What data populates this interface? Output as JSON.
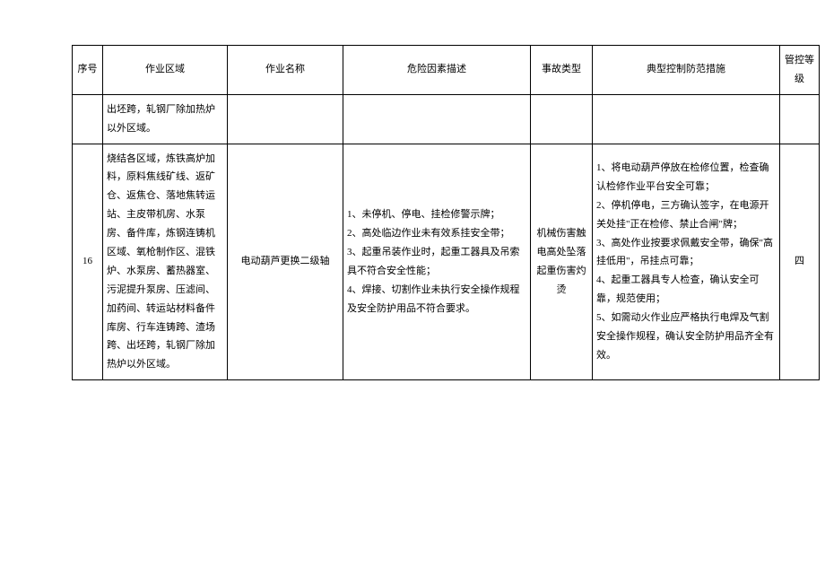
{
  "header": {
    "seq": "序号",
    "area": "作业区域",
    "name": "作业名称",
    "hazard": "危险因素描述",
    "type": "事故类型",
    "measure": "典型控制防范措施",
    "level": "管控等级"
  },
  "row_partial": {
    "seq": "",
    "area": "出坯跨，轧钢厂除加热炉以外区域。",
    "name": "",
    "hazard": "",
    "type": "",
    "measure": "",
    "level": ""
  },
  "row_16": {
    "seq": "16",
    "area": "烧结各区域，炼铁高炉加料，原料焦线矿线、返矿仓、返焦仓、落地焦转运站、主皮带机房、水泵房、备件库，炼钢连铸机区域、氧枪制作区、混铁炉、水泵房、蓄热器室、污泥提升泵房、压滤间、加药间、转运站材料备件库房、行车连铸跨、渣场跨、出坯跨，轧钢厂除加热炉以外区域。",
    "name": "电动葫芦更换二级轴",
    "hazard": "1、未停机、停电、挂检修警示牌；\n2、高处临边作业未有效系挂安全带；\n3、起重吊装作业时，起重工器具及吊索具不符合安全性能；\n4、焊接、切割作业未执行安全操作规程及安全防护用品不符合要求。",
    "type": "机械伤害触电高处坠落起重伤害灼烫",
    "measure": "1、将电动葫芦停放在检修位置，检查确认检修作业平台安全可靠；\n2、停机停电，三方确认签字，在电源开关处挂\"正在检修、禁止合闸\"牌；\n3、高处作业按要求佩戴安全带，确保\"高挂低用\"，吊挂点可靠；\n4、起重工器具专人检查，确认安全可靠，规范使用；\n5、如需动火作业应严格执行电焊及气割安全操作规程，确认安全防护用品齐全有效。",
    "level": "四"
  }
}
